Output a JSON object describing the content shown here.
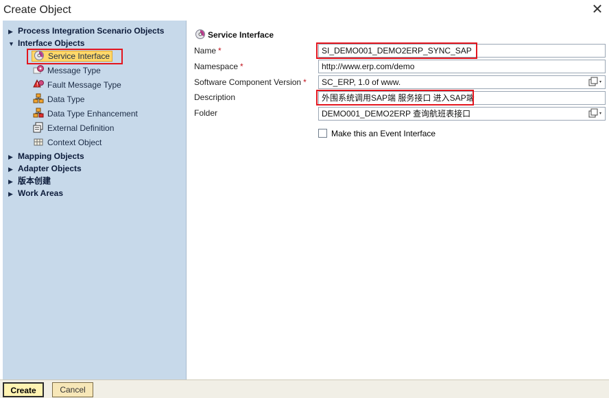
{
  "window": {
    "title": "Create Object",
    "close_symbol": "✕"
  },
  "sidebar": {
    "groups": [
      {
        "label": "Process Integration Scenario Objects",
        "expanded": false
      },
      {
        "label": "Interface Objects",
        "expanded": true,
        "children": [
          {
            "label": "Service Interface",
            "icon": "service-interface-icon",
            "selected": true
          },
          {
            "label": "Message Type",
            "icon": "message-type-icon"
          },
          {
            "label": "Fault Message Type",
            "icon": "fault-message-type-icon"
          },
          {
            "label": "Data Type",
            "icon": "data-type-icon"
          },
          {
            "label": "Data Type Enhancement",
            "icon": "data-type-enhancement-icon"
          },
          {
            "label": "External Definition",
            "icon": "external-definition-icon"
          },
          {
            "label": "Context Object",
            "icon": "context-object-icon"
          }
        ]
      },
      {
        "label": "Mapping Objects",
        "expanded": false
      },
      {
        "label": "Adapter Objects",
        "expanded": false
      },
      {
        "label": "版本创建",
        "expanded": false
      },
      {
        "label": "Work Areas",
        "expanded": false
      }
    ]
  },
  "form": {
    "header": "Service Interface",
    "fields": [
      {
        "label": "Name",
        "required": true,
        "value": "SI_DEMO001_DEMO2ERP_SYNC_SAP",
        "has_dropdown": false
      },
      {
        "label": "Namespace",
        "required": true,
        "value": "http://www.erp.com/demo",
        "has_dropdown": false
      },
      {
        "label": "Software Component Version",
        "required": true,
        "value": "SC_ERP, 1.0 of www.",
        "has_dropdown": true
      },
      {
        "label": "Description",
        "required": false,
        "value": "外围系统调用SAP端 服务接口 进入SAP端",
        "has_dropdown": false
      },
      {
        "label": "Folder",
        "required": false,
        "value": "DEMO001_DEMO2ERP 查询航班表接口",
        "has_dropdown": true
      }
    ],
    "event_checkbox": {
      "label": "Make this an Event Interface",
      "checked": false
    }
  },
  "footer": {
    "create_label": "Create",
    "cancel_label": "Cancel"
  },
  "colors": {
    "sidebar_bg": "#c7d9ea",
    "highlight": "#ffd86a",
    "annotation_red": "#e3141d",
    "required_star": "#c1121c"
  }
}
